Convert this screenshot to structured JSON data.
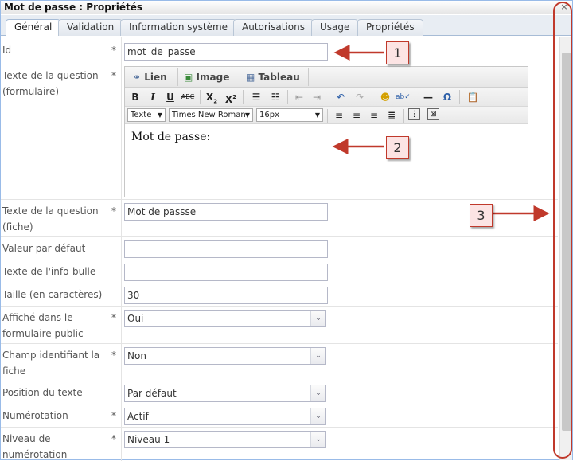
{
  "window": {
    "title": "Mot de passe : Propriétés",
    "close": "×"
  },
  "tabs": [
    "Général",
    "Validation",
    "Information système",
    "Autorisations",
    "Usage",
    "Propriétés"
  ],
  "fields": {
    "id": {
      "label": "Id",
      "required": "*",
      "value": "mot_de_passe"
    },
    "question_form": {
      "label_line1": "Texte de la question",
      "label_line2": "(formulaire)",
      "required": "*"
    },
    "question_fiche": {
      "label_line1": "Texte de la question",
      "label_line2": "(fiche)",
      "required": "*",
      "value": "Mot de passse"
    },
    "default_value": {
      "label": "Valeur par défaut",
      "value": ""
    },
    "tooltip": {
      "label": "Texte de l'info-bulle",
      "value": ""
    },
    "size": {
      "label": "Taille (en caractères)",
      "value": "30"
    },
    "public": {
      "label_line1": "Affiché dans le",
      "label_line2": "formulaire public",
      "required": "*",
      "value": "Oui"
    },
    "identifier": {
      "label_line1": "Champ identifiant la",
      "label_line2": "fiche",
      "required": "*",
      "value": "Non"
    },
    "text_position": {
      "label": "Position du texte",
      "value": "Par défaut"
    },
    "numbering": {
      "label": "Numérotation",
      "required": "*",
      "value": "Actif"
    },
    "numbering_level": {
      "label_line1": "Niveau de",
      "label_line2": "numérotation",
      "required": "*",
      "value": "Niveau 1"
    }
  },
  "editor": {
    "link_label": "Lien",
    "image_label": "Image",
    "table_label": "Tableau",
    "format_dropdown": "Texte",
    "font_dropdown": "Times New Roman",
    "size_dropdown": "16px",
    "content": "Mot de passe:"
  },
  "callouts": [
    "1",
    "2",
    "3"
  ],
  "colors": {
    "accent": "#c0392b",
    "callout_fill": "#fce4e4",
    "tab_border": "#a7bcd6"
  }
}
